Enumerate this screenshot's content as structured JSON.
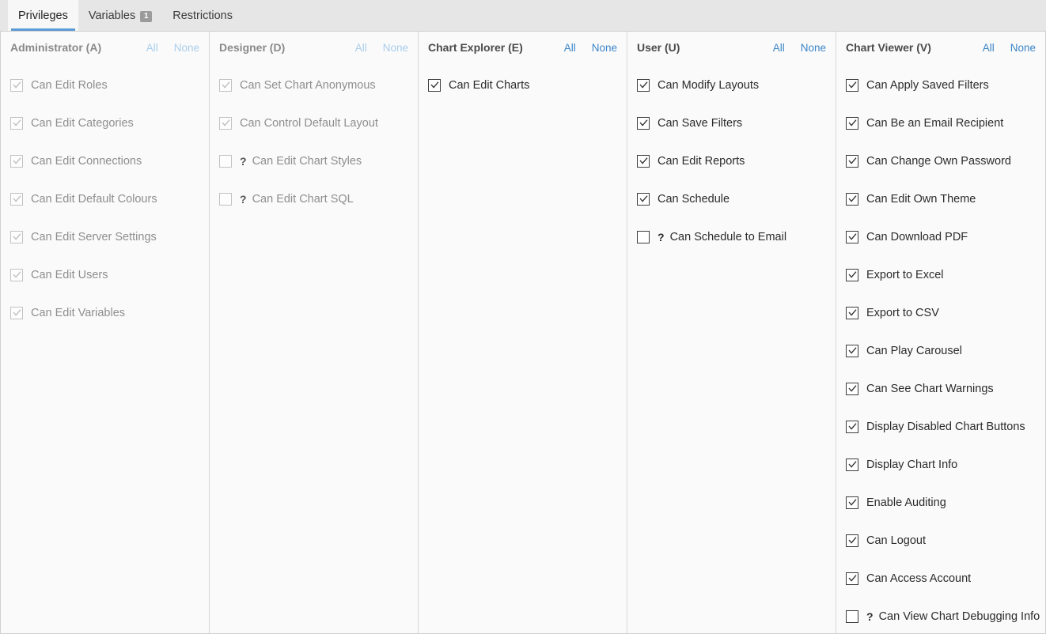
{
  "tabs": [
    {
      "label": "Privileges",
      "active": true,
      "badge": null
    },
    {
      "label": "Variables",
      "active": false,
      "badge": "1"
    },
    {
      "label": "Restrictions",
      "active": false,
      "badge": null
    }
  ],
  "links": {
    "all_label": "All",
    "none_label": "None"
  },
  "colors": {
    "accent": "#5b9bd5",
    "link": "#3c86c8",
    "link_disabled": "#a9cdec",
    "tabbar_bg": "#e6e6e6",
    "panel_bg": "#fafafa",
    "badge_bg": "#9b9b9b"
  },
  "columns": [
    {
      "title": "Administrator (A)",
      "key": "administrator",
      "enabled": false,
      "items": [
        {
          "label": "Can Edit Roles",
          "checked": true,
          "disabled": true,
          "help": false
        },
        {
          "label": "Can Edit Categories",
          "checked": true,
          "disabled": true,
          "help": false
        },
        {
          "label": "Can Edit Connections",
          "checked": true,
          "disabled": true,
          "help": false
        },
        {
          "label": "Can Edit Default Colours",
          "checked": true,
          "disabled": true,
          "help": false
        },
        {
          "label": "Can Edit Server Settings",
          "checked": true,
          "disabled": true,
          "help": false
        },
        {
          "label": "Can Edit Users",
          "checked": true,
          "disabled": true,
          "help": false
        },
        {
          "label": "Can Edit Variables",
          "checked": true,
          "disabled": true,
          "help": false
        }
      ]
    },
    {
      "title": "Designer (D)",
      "key": "designer",
      "enabled": false,
      "items": [
        {
          "label": "Can Set Chart Anonymous",
          "checked": true,
          "disabled": true,
          "help": false
        },
        {
          "label": "Can Control Default Layout",
          "checked": true,
          "disabled": true,
          "help": false
        },
        {
          "label": "Can Edit Chart Styles",
          "checked": false,
          "disabled": true,
          "help": true
        },
        {
          "label": "Can Edit Chart SQL",
          "checked": false,
          "disabled": true,
          "help": true
        }
      ]
    },
    {
      "title": "Chart Explorer (E)",
      "key": "chart_explorer",
      "enabled": true,
      "items": [
        {
          "label": "Can Edit Charts",
          "checked": true,
          "disabled": false,
          "help": false
        }
      ]
    },
    {
      "title": "User (U)",
      "key": "user",
      "enabled": true,
      "items": [
        {
          "label": "Can Modify Layouts",
          "checked": true,
          "disabled": false,
          "help": false
        },
        {
          "label": "Can Save Filters",
          "checked": true,
          "disabled": false,
          "help": false
        },
        {
          "label": "Can Edit Reports",
          "checked": true,
          "disabled": false,
          "help": false
        },
        {
          "label": "Can Schedule",
          "checked": true,
          "disabled": false,
          "help": false
        },
        {
          "label": "Can Schedule to Email",
          "checked": false,
          "disabled": false,
          "help": true
        }
      ]
    },
    {
      "title": "Chart Viewer (V)",
      "key": "chart_viewer",
      "enabled": true,
      "items": [
        {
          "label": "Can Apply Saved Filters",
          "checked": true,
          "disabled": false,
          "help": false
        },
        {
          "label": "Can Be an Email Recipient",
          "checked": true,
          "disabled": false,
          "help": false
        },
        {
          "label": "Can Change Own Password",
          "checked": true,
          "disabled": false,
          "help": false
        },
        {
          "label": "Can Edit Own Theme",
          "checked": true,
          "disabled": false,
          "help": false
        },
        {
          "label": "Can Download PDF",
          "checked": true,
          "disabled": false,
          "help": false
        },
        {
          "label": "Export to Excel",
          "checked": true,
          "disabled": false,
          "help": false
        },
        {
          "label": "Export to CSV",
          "checked": true,
          "disabled": false,
          "help": false
        },
        {
          "label": "Can Play Carousel",
          "checked": true,
          "disabled": false,
          "help": false
        },
        {
          "label": "Can See Chart Warnings",
          "checked": true,
          "disabled": false,
          "help": false
        },
        {
          "label": "Display Disabled Chart Buttons",
          "checked": true,
          "disabled": false,
          "help": false
        },
        {
          "label": "Display Chart Info",
          "checked": true,
          "disabled": false,
          "help": false
        },
        {
          "label": "Enable Auditing",
          "checked": true,
          "disabled": false,
          "help": false
        },
        {
          "label": "Can Logout",
          "checked": true,
          "disabled": false,
          "help": false
        },
        {
          "label": "Can Access Account",
          "checked": true,
          "disabled": false,
          "help": false
        },
        {
          "label": "Can View Chart Debugging Info",
          "checked": false,
          "disabled": false,
          "help": true
        }
      ]
    }
  ],
  "icons": {
    "check": "check-icon",
    "help": "?"
  }
}
